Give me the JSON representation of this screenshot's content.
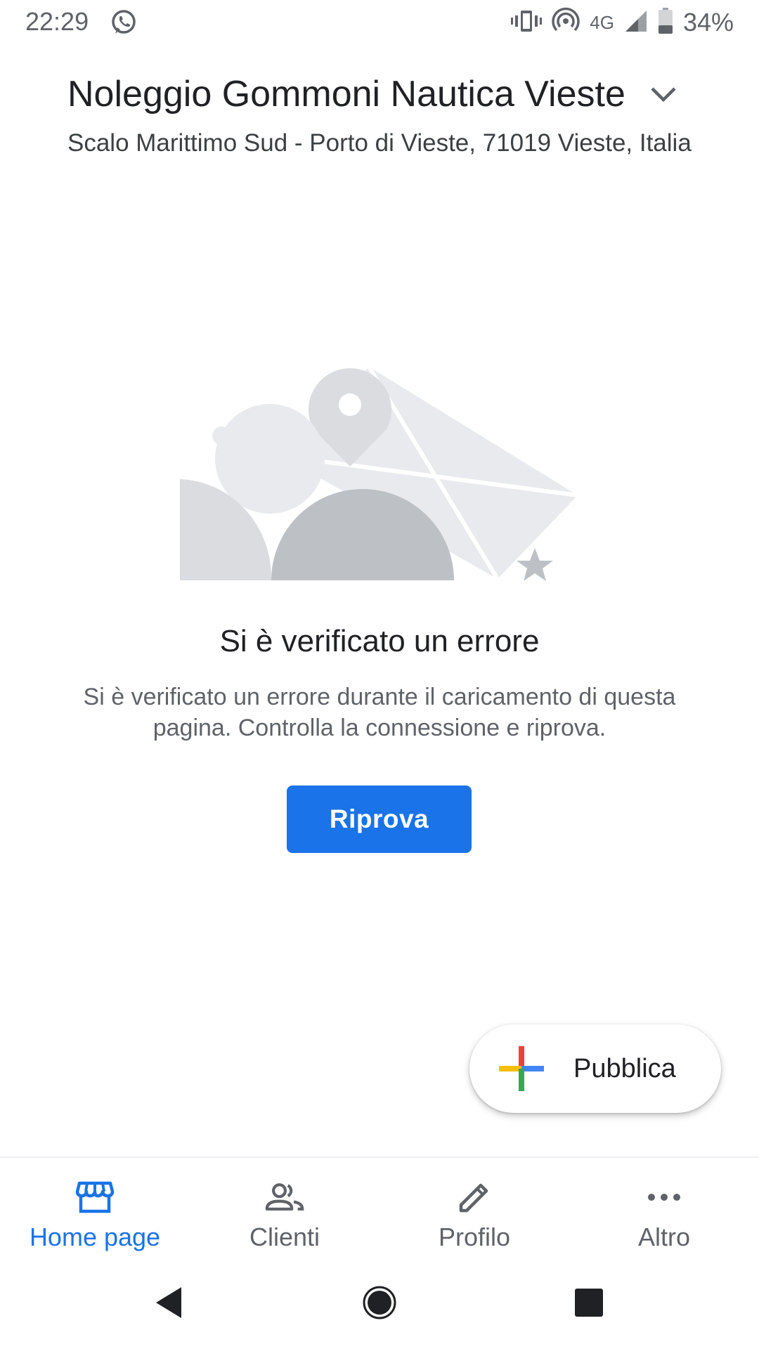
{
  "status_bar": {
    "time": "22:29",
    "network": "4G",
    "battery_percent": "34%",
    "icons": [
      "whatsapp-icon",
      "vibrate-icon",
      "hotspot-icon",
      "signal-icon",
      "battery-icon"
    ]
  },
  "header": {
    "business_name": "Noleggio Gommoni Nautica Vieste",
    "address": "Scalo Marittimo Sud - Porto di Vieste, 71019 Vieste, Italia"
  },
  "error": {
    "title": "Si è verificato un errore",
    "message": "Si è verificato un errore durante il caricamento di questa pagina. Controlla la connessione e riprova.",
    "retry_label": "Riprova"
  },
  "fab": {
    "label": "Pubblica",
    "icon": "google-plus-icon"
  },
  "bottom_nav": {
    "items": [
      {
        "label": "Home page",
        "icon": "storefront-icon",
        "active": true
      },
      {
        "label": "Clienti",
        "icon": "people-icon",
        "active": false
      },
      {
        "label": "Profilo",
        "icon": "pencil-icon",
        "active": false
      },
      {
        "label": "Altro",
        "icon": "more-horizontal-icon",
        "active": false
      }
    ]
  },
  "colors": {
    "accent": "#1a73e8",
    "text_primary": "#202124",
    "text_secondary": "#5f6368",
    "google_red": "#ea4335",
    "google_blue": "#4285f4",
    "google_yellow": "#fbbc04",
    "google_green": "#34a853"
  }
}
